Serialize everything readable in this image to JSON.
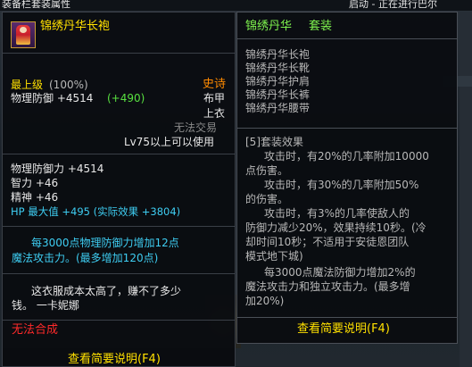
{
  "background": {
    "top_left_text": "装备栏套装属性",
    "top_right_text": "启动 - 正在进行巴尔"
  },
  "left_tooltip": {
    "item_name": "锦绣丹华长袍",
    "grade": "最上级",
    "grade_percent": "(100%)",
    "rarity": "史诗",
    "slot_type": "布甲",
    "slot_part": "上衣",
    "physical_defense": "物理防御 +4514",
    "physical_defense_bonus": "(+490)",
    "trade": "无法交易",
    "level_req": "Lv75以上可以使用",
    "stats": [
      "物理防御力 +4514",
      "智力 +46",
      "精神 +46"
    ],
    "hp_line": "HP 最大值 +495 (实际效果 +3804)",
    "effect_lines": [
      "每3000点物理防御力增加12点",
      "魔法攻击力。(最多增加120点)"
    ],
    "flavor_lines": [
      "这衣服成本太高了，赚不了多少",
      "钱。 一卡妮娜"
    ],
    "no_combine": "无法合成",
    "view_brief": "查看简要说明(F4)"
  },
  "right_tooltip": {
    "set_name": "锦绣丹华",
    "set_label": "套装",
    "set_items": [
      "锦绣丹华长袍",
      "锦绣丹华长靴",
      "锦绣丹华护肩",
      "锦绣丹华长裤",
      "锦绣丹华腰带"
    ],
    "set_effect_header": "[5]套装效果",
    "set_effect_lines": [
      "攻击时，有20%的几率附加10000",
      "点伤害。",
      "攻击时，有30%的几率附加50%",
      "的伤害。",
      "攻击时，有3%的几率使敌人的",
      "防御力减少20%，效果持续10秒。(冷",
      "却时间10秒；不适用于安徒恩团队",
      "模式地下城)",
      "每3000点魔法防御力增加2%的",
      "魔法攻击力和独立攻击力。(最多增",
      "加20%)"
    ],
    "view_brief": "查看简要说明(F4)"
  },
  "colors": {
    "title_gold": "#ffe000",
    "set_green": "#58e040",
    "stat_blue": "#3ecdf2",
    "warn_red": "#ff2a2a",
    "epic_orange": "#ff8a00"
  }
}
